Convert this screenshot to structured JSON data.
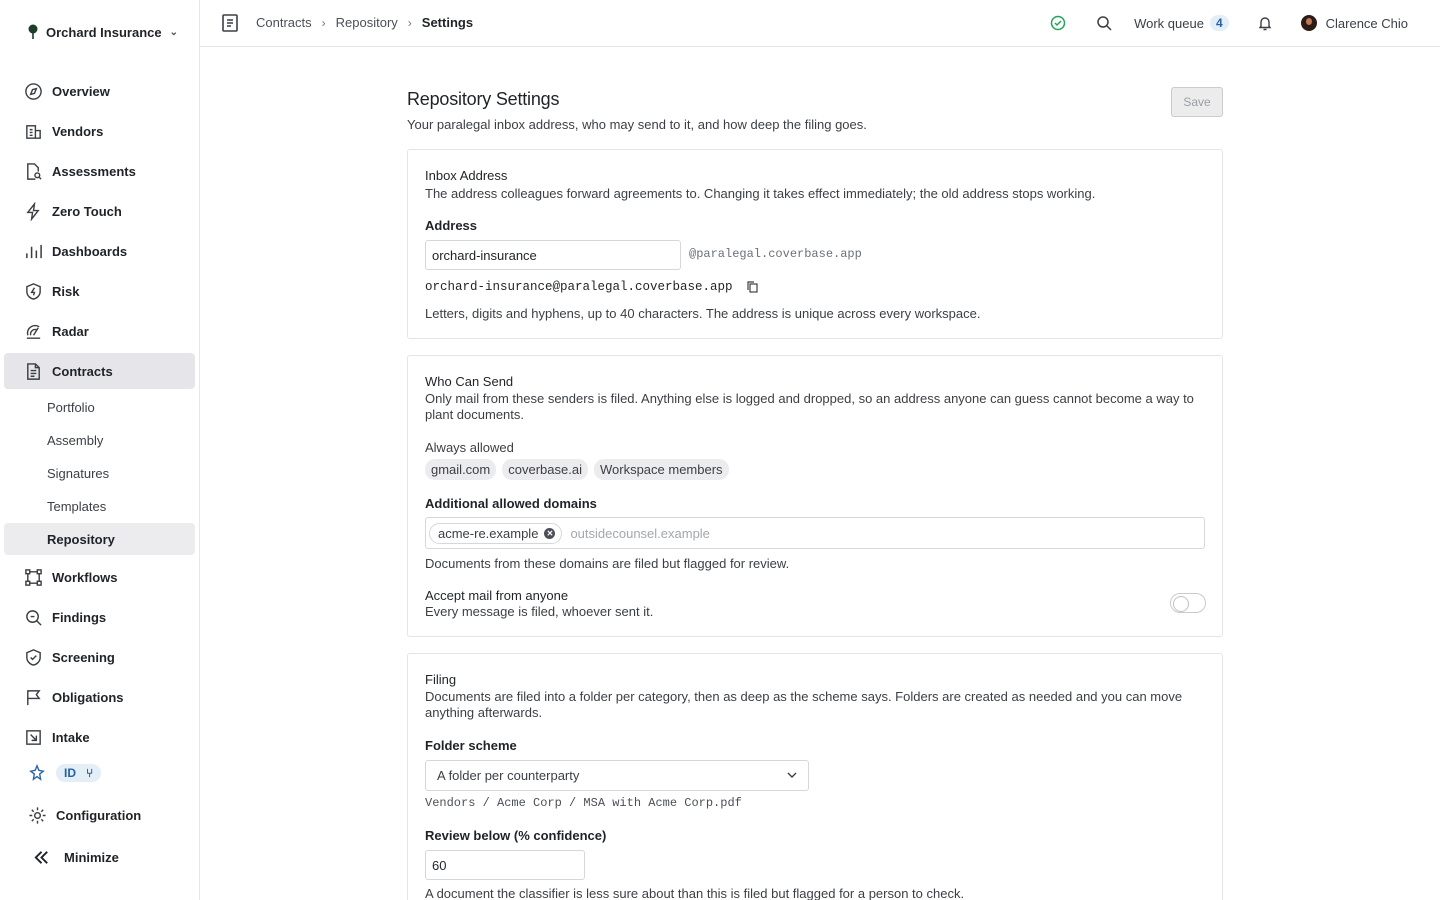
{
  "org": {
    "name": "Orchard Insurance"
  },
  "sidebar": {
    "items": [
      {
        "label": "Overview",
        "icon": "compass-icon"
      },
      {
        "label": "Vendors",
        "icon": "building-icon"
      },
      {
        "label": "Assessments",
        "icon": "document-search-icon"
      },
      {
        "label": "Zero Touch",
        "icon": "bolt-icon"
      },
      {
        "label": "Dashboards",
        "icon": "bar-chart-icon"
      },
      {
        "label": "Risk",
        "icon": "shield-bolt-icon"
      },
      {
        "label": "Radar",
        "icon": "radar-icon"
      },
      {
        "label": "Contracts",
        "icon": "contract-icon"
      }
    ],
    "contracts_sub": [
      "Portfolio",
      "Assembly",
      "Signatures",
      "Templates",
      "Repository"
    ],
    "items_after": [
      {
        "label": "Workflows",
        "icon": "workflow-icon"
      },
      {
        "label": "Findings",
        "icon": "magnifier-icon"
      },
      {
        "label": "Screening",
        "icon": "shield-check-icon"
      },
      {
        "label": "Obligations",
        "icon": "flag-icon"
      },
      {
        "label": "Intake",
        "icon": "intake-icon"
      }
    ],
    "id_pill": "ID",
    "configuration": "Configuration",
    "minimize": "Minimize"
  },
  "topbar": {
    "breadcrumb": [
      "Contracts",
      "Repository",
      "Settings"
    ],
    "work_queue_label": "Work queue",
    "work_queue_count": "4",
    "user_name": "Clarence Chio"
  },
  "page": {
    "title": "Repository Settings",
    "subtitle": "Your paralegal inbox address, who may send to it, and how deep the filing goes.",
    "save_label": "Save"
  },
  "inbox": {
    "title": "Inbox Address",
    "description": "The address colleagues forward agreements to. Changing it takes effect immediately; the old address stops working.",
    "address_label": "Address",
    "address_value": "orchard-insurance",
    "suffix": "@paralegal.coverbase.app",
    "full_address": "orchard-insurance@paralegal.coverbase.app",
    "help": "Letters, digits and hyphens, up to 40 characters. The address is unique across every workspace."
  },
  "senders": {
    "title": "Who Can Send",
    "description": "Only mail from these senders is filed. Anything else is logged and dropped, so an address anyone can guess cannot become a way to plant documents.",
    "always_label": "Always allowed",
    "always": [
      "gmail.com",
      "coverbase.ai",
      "Workspace members"
    ],
    "additional_label": "Additional allowed domains",
    "additional_tags": [
      "acme-re.example"
    ],
    "additional_placeholder": "outsidecounsel.example",
    "additional_help": "Documents from these domains are filed but flagged for review.",
    "anyone_title": "Accept mail from anyone",
    "anyone_desc": "Every message is filed, whoever sent it.",
    "anyone_enabled": false
  },
  "filing": {
    "title": "Filing",
    "description": "Documents are filed into a folder per category, then as deep as the scheme says. Folders are created as needed and you can move anything afterwards.",
    "scheme_label": "Folder scheme",
    "scheme_value": "A folder per counterparty",
    "scheme_example": "Vendors / Acme Corp / MSA with Acme Corp.pdf",
    "review_label": "Review below (% confidence)",
    "review_value": "60",
    "review_help": "A document the classifier is less sure about than this is filed but flagged for a person to check."
  },
  "colors": {
    "accent": "#2563a8",
    "success": "#22a55a",
    "active_nav": "#e6e6ea"
  }
}
